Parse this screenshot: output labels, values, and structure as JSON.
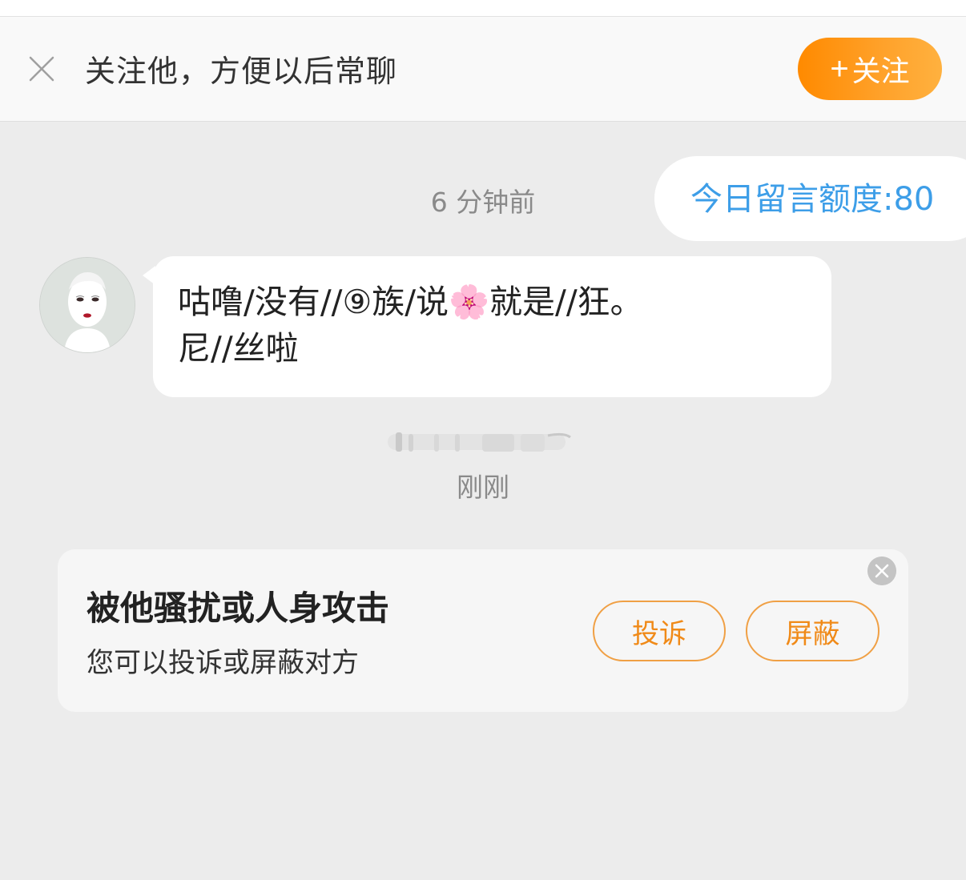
{
  "follow_bar": {
    "prompt": "关注他，方便以后常聊",
    "plus": "+",
    "follow_label": "关注"
  },
  "quota": {
    "text": "今日留言额度:80"
  },
  "timestamps": {
    "first": "6 分钟前",
    "second": "刚刚"
  },
  "message": {
    "line1": "咕噜/没有//⑨族/说🌸就是//狂。",
    "line2": "尼//丝啦"
  },
  "report_card": {
    "title": "被他骚扰或人身攻击",
    "subtitle": "您可以投诉或屏蔽对方",
    "report_label": "投诉",
    "block_label": "屏蔽"
  },
  "colors": {
    "accent_orange": "#ff8a00",
    "quota_blue": "#3d9ee8",
    "background": "#ececec"
  },
  "icons": {
    "close": "close-icon",
    "card_close": "circle-close-icon"
  }
}
